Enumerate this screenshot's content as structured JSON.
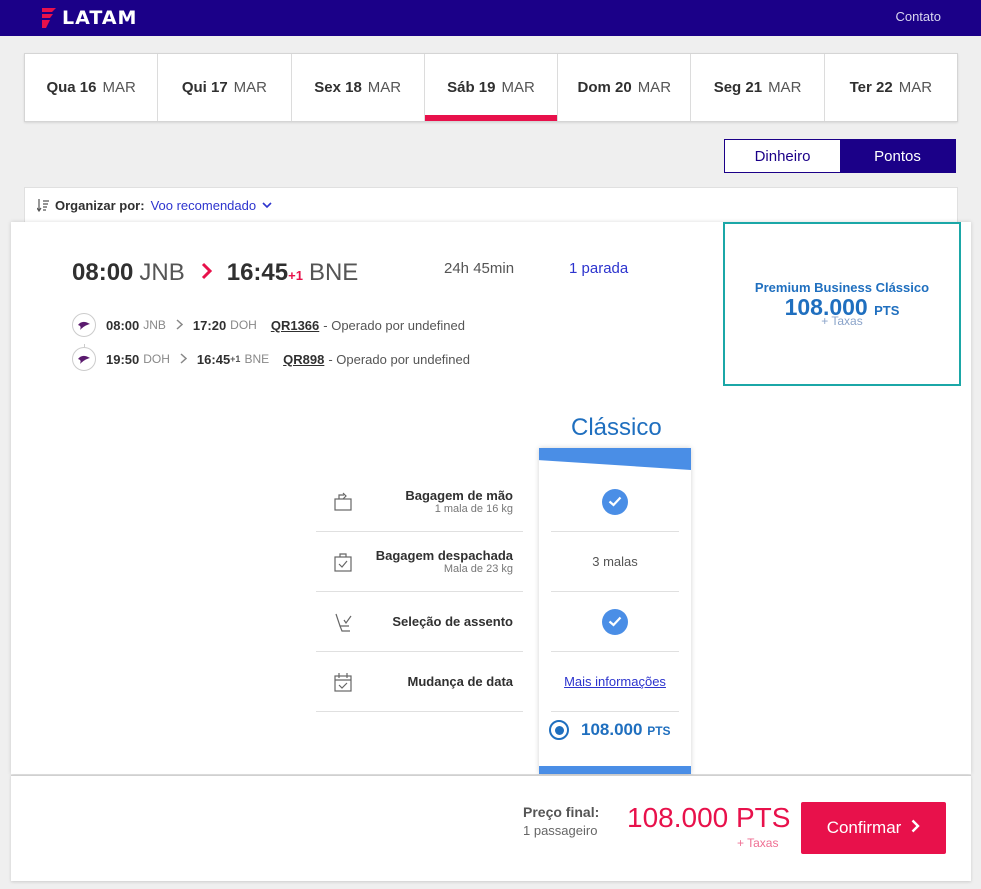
{
  "header": {
    "brand": "LATAM",
    "contact": "Contato"
  },
  "dates": [
    {
      "day": "Qua 16",
      "month": "MAR",
      "active": false
    },
    {
      "day": "Qui 17",
      "month": "MAR",
      "active": false
    },
    {
      "day": "Sex 18",
      "month": "MAR",
      "active": false
    },
    {
      "day": "Sáb 19",
      "month": "MAR",
      "active": true
    },
    {
      "day": "Dom 20",
      "month": "MAR",
      "active": false
    },
    {
      "day": "Seg 21",
      "month": "MAR",
      "active": false
    },
    {
      "day": "Ter 22",
      "month": "MAR",
      "active": false
    }
  ],
  "currency_toggle": {
    "money": "Dinheiro",
    "points": "Pontos",
    "selected": "Pontos"
  },
  "sort": {
    "label": "Organizar por:",
    "value": "Voo recomendado"
  },
  "flight": {
    "depart_time": "08:00",
    "depart_airport": "JNB",
    "arrive_time": "16:45",
    "arrive_plus": "+1",
    "arrive_airport": "BNE",
    "duration": "24h 45min",
    "stops": "1 parada",
    "segments": [
      {
        "dep_time": "08:00",
        "dep_ap": "JNB",
        "arr_time": "17:20",
        "arr_plus": "",
        "arr_ap": "DOH",
        "flight": "QR1366",
        "operator": "- Operado por undefined"
      },
      {
        "dep_time": "19:50",
        "dep_ap": "DOH",
        "arr_time": "16:45",
        "arr_plus": "+1",
        "arr_ap": "BNE",
        "flight": "QR898",
        "operator": "- Operado por undefined"
      }
    ]
  },
  "fare_card": {
    "name": "Premium Business Clássico",
    "price": "108.000",
    "unit": "PTS",
    "taxes": "+ Taxas"
  },
  "features": [
    {
      "name": "Bagagem de mão",
      "sub": "1 mala de 16 kg",
      "icon": "carry-on-bag-icon"
    },
    {
      "name": "Bagagem despachada",
      "sub": "Mala de 23 kg",
      "icon": "checked-bag-icon"
    },
    {
      "name": "Seleção de assento",
      "sub": "",
      "icon": "seat-icon"
    },
    {
      "name": "Mudança de data",
      "sub": "",
      "icon": "calendar-icon"
    }
  ],
  "classic": {
    "title": "Clássico",
    "baggage_cabin": "✓",
    "baggage_checked": "3 malas",
    "seat": "✓",
    "change": "Mais informações",
    "price": "108.000",
    "unit": "PTS"
  },
  "footer": {
    "label": "Preço final:",
    "passengers": "1 passageiro",
    "price": "108.000 PTS",
    "taxes": "+ Taxas",
    "confirm": "Confirmar"
  },
  "colors": {
    "brand": "#1b0088",
    "accent": "#e8114b",
    "blue": "#1f6fbf",
    "teal": "#1ba7a7"
  }
}
